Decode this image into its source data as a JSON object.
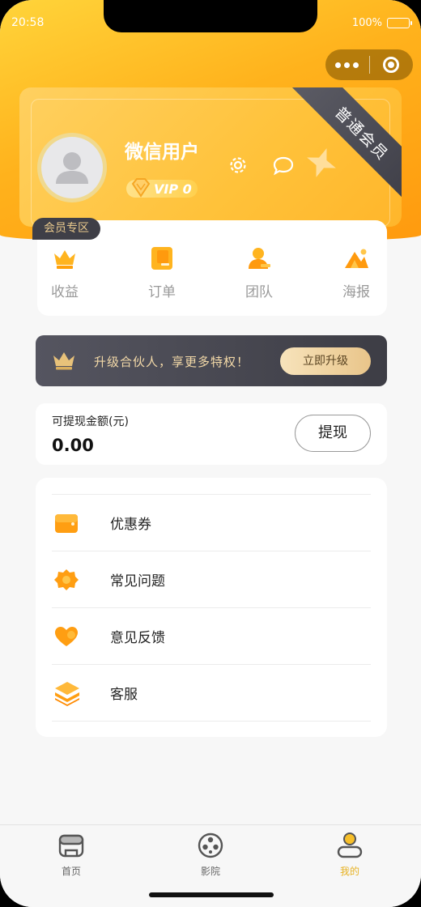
{
  "status_bar": {
    "time": "20:58",
    "battery": "100%"
  },
  "profile": {
    "username": "微信用户",
    "vip_level": "VIP 0",
    "member_ribbon": "普通会员"
  },
  "member_zone": {
    "tag": "会员专区",
    "items": [
      {
        "label": "收益",
        "icon": "crown-icon"
      },
      {
        "label": "订单",
        "icon": "order-icon"
      },
      {
        "label": "团队",
        "icon": "team-icon"
      },
      {
        "label": "海报",
        "icon": "poster-icon"
      }
    ]
  },
  "upgrade": {
    "text": "升级合伙人，享更多特权！",
    "button": "立即升级"
  },
  "withdraw": {
    "label": "可提现金额(元)",
    "amount": "0.00",
    "button": "提现"
  },
  "menu": {
    "items": [
      {
        "label": "优惠券",
        "icon": "wallet-icon"
      },
      {
        "label": "常见问题",
        "icon": "question-icon"
      },
      {
        "label": "意见反馈",
        "icon": "heart-icon"
      },
      {
        "label": "客服",
        "icon": "layers-icon"
      }
    ]
  },
  "tabbar": {
    "tabs": [
      {
        "label": "首页",
        "icon": "home-icon",
        "active": false
      },
      {
        "label": "影院",
        "icon": "film-reel-icon",
        "active": false
      },
      {
        "label": "我的",
        "icon": "profile-icon",
        "active": true
      }
    ]
  },
  "colors": {
    "accent": "#FFB21C",
    "active_tab": "#E7B223",
    "dark_banner": "#45454D"
  }
}
